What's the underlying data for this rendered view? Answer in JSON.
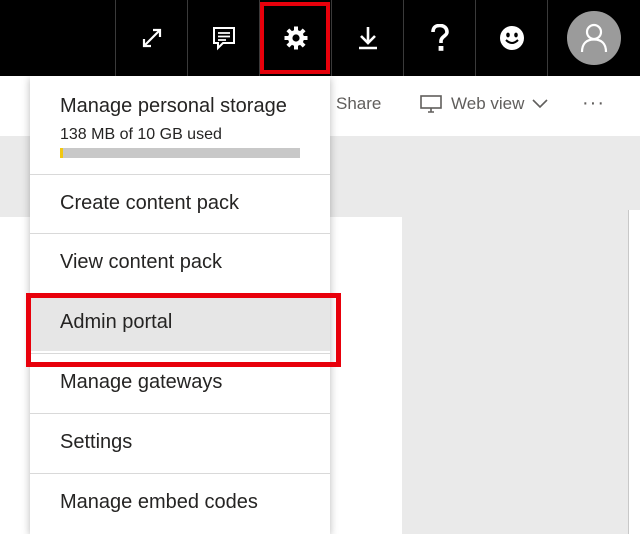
{
  "topbar": {
    "buttons": [
      {
        "name": "fullscreen",
        "icon": "expand-icon"
      },
      {
        "name": "feedback",
        "icon": "feedback-icon"
      },
      {
        "name": "settings",
        "icon": "gear-icon",
        "highlighted": true
      },
      {
        "name": "download",
        "icon": "download-icon"
      },
      {
        "name": "help",
        "icon": "help-icon"
      },
      {
        "name": "smiley",
        "icon": "smiley-icon"
      }
    ],
    "avatar_icon": "user-icon"
  },
  "subbar": {
    "share_label": "Share",
    "web_view_label": "Web view",
    "more_label": "···"
  },
  "menu": {
    "storage_title": "Manage personal storage",
    "storage_usage": "138 MB of 10 GB used",
    "storage_used_fraction": 0.0135,
    "items": [
      {
        "label": "Create content pack"
      },
      {
        "label": "View content pack"
      },
      {
        "label": "Admin portal",
        "highlighted": true
      },
      {
        "label": "Manage gateways"
      },
      {
        "label": "Settings"
      },
      {
        "label": "Manage embed codes"
      }
    ]
  },
  "colors": {
    "topbar": "#000000",
    "highlight": "#e8000b",
    "storage_fill": "#f2c811",
    "storage_track": "#c8c8c8",
    "canvas": "#eaeaea"
  }
}
